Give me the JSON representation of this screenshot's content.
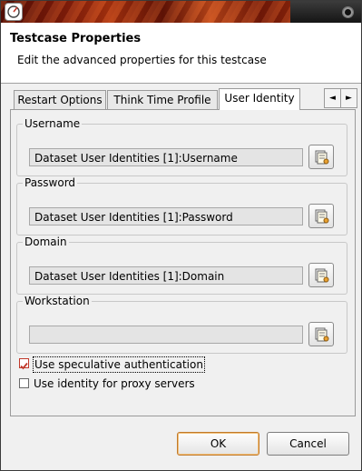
{
  "window": {
    "title": ""
  },
  "header": {
    "title": "Testcase Properties",
    "description": "Edit the advanced properties for this testcase"
  },
  "tabs": [
    {
      "label": "Restart Options",
      "active": false
    },
    {
      "label": "Think Time Profile",
      "active": false
    },
    {
      "label": "User Identity",
      "active": true
    }
  ],
  "tab_scroll": {
    "left": "◄",
    "right": "►"
  },
  "groups": {
    "username": {
      "label": "Username",
      "value": "Dataset User Identities [1]:Username"
    },
    "password": {
      "label": "Password",
      "value": "Dataset User Identities [1]:Password"
    },
    "domain": {
      "label": "Domain",
      "value": "Dataset User Identities [1]:Domain"
    },
    "workstation": {
      "label": "Workstation",
      "value": ""
    }
  },
  "icons": {
    "browse": "dataset-picker-icon",
    "app": "application-icon",
    "close": "close-icon"
  },
  "checkboxes": {
    "speculative": {
      "label": "Use speculative authentication",
      "checked": true
    },
    "proxy": {
      "label": "Use identity for proxy servers",
      "checked": false
    }
  },
  "buttons": {
    "ok": "OK",
    "cancel": "Cancel"
  },
  "colors": {
    "check": "#c0392b",
    "default_button_border": "#c0792a"
  }
}
